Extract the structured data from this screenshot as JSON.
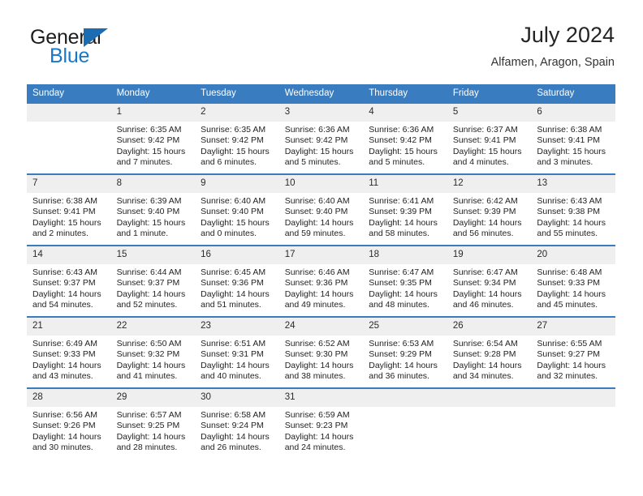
{
  "brand": {
    "name_top": "General",
    "name_bottom": "Blue",
    "colors": {
      "dark": "#1d1d1b",
      "blue": "#1877c9",
      "triangle": "#1b6cb3"
    }
  },
  "header": {
    "title": "July 2024",
    "subtitle": "Alfamen, Aragon, Spain"
  },
  "theme": {
    "header_bg": "#3a7cc0",
    "daynum_bg": "#efefef",
    "row_divider": "#3a7cc0",
    "text": "#232323"
  },
  "weekdays": [
    "Sunday",
    "Monday",
    "Tuesday",
    "Wednesday",
    "Thursday",
    "Friday",
    "Saturday"
  ],
  "weeks": [
    [
      {
        "day": "",
        "sunrise": "",
        "sunset": "",
        "daylight_1": "",
        "daylight_2": ""
      },
      {
        "day": "1",
        "sunrise": "Sunrise: 6:35 AM",
        "sunset": "Sunset: 9:42 PM",
        "daylight_1": "Daylight: 15 hours",
        "daylight_2": "and 7 minutes."
      },
      {
        "day": "2",
        "sunrise": "Sunrise: 6:35 AM",
        "sunset": "Sunset: 9:42 PM",
        "daylight_1": "Daylight: 15 hours",
        "daylight_2": "and 6 minutes."
      },
      {
        "day": "3",
        "sunrise": "Sunrise: 6:36 AM",
        "sunset": "Sunset: 9:42 PM",
        "daylight_1": "Daylight: 15 hours",
        "daylight_2": "and 5 minutes."
      },
      {
        "day": "4",
        "sunrise": "Sunrise: 6:36 AM",
        "sunset": "Sunset: 9:42 PM",
        "daylight_1": "Daylight: 15 hours",
        "daylight_2": "and 5 minutes."
      },
      {
        "day": "5",
        "sunrise": "Sunrise: 6:37 AM",
        "sunset": "Sunset: 9:41 PM",
        "daylight_1": "Daylight: 15 hours",
        "daylight_2": "and 4 minutes."
      },
      {
        "day": "6",
        "sunrise": "Sunrise: 6:38 AM",
        "sunset": "Sunset: 9:41 PM",
        "daylight_1": "Daylight: 15 hours",
        "daylight_2": "and 3 minutes."
      }
    ],
    [
      {
        "day": "7",
        "sunrise": "Sunrise: 6:38 AM",
        "sunset": "Sunset: 9:41 PM",
        "daylight_1": "Daylight: 15 hours",
        "daylight_2": "and 2 minutes."
      },
      {
        "day": "8",
        "sunrise": "Sunrise: 6:39 AM",
        "sunset": "Sunset: 9:40 PM",
        "daylight_1": "Daylight: 15 hours",
        "daylight_2": "and 1 minute."
      },
      {
        "day": "9",
        "sunrise": "Sunrise: 6:40 AM",
        "sunset": "Sunset: 9:40 PM",
        "daylight_1": "Daylight: 15 hours",
        "daylight_2": "and 0 minutes."
      },
      {
        "day": "10",
        "sunrise": "Sunrise: 6:40 AM",
        "sunset": "Sunset: 9:40 PM",
        "daylight_1": "Daylight: 14 hours",
        "daylight_2": "and 59 minutes."
      },
      {
        "day": "11",
        "sunrise": "Sunrise: 6:41 AM",
        "sunset": "Sunset: 9:39 PM",
        "daylight_1": "Daylight: 14 hours",
        "daylight_2": "and 58 minutes."
      },
      {
        "day": "12",
        "sunrise": "Sunrise: 6:42 AM",
        "sunset": "Sunset: 9:39 PM",
        "daylight_1": "Daylight: 14 hours",
        "daylight_2": "and 56 minutes."
      },
      {
        "day": "13",
        "sunrise": "Sunrise: 6:43 AM",
        "sunset": "Sunset: 9:38 PM",
        "daylight_1": "Daylight: 14 hours",
        "daylight_2": "and 55 minutes."
      }
    ],
    [
      {
        "day": "14",
        "sunrise": "Sunrise: 6:43 AM",
        "sunset": "Sunset: 9:37 PM",
        "daylight_1": "Daylight: 14 hours",
        "daylight_2": "and 54 minutes."
      },
      {
        "day": "15",
        "sunrise": "Sunrise: 6:44 AM",
        "sunset": "Sunset: 9:37 PM",
        "daylight_1": "Daylight: 14 hours",
        "daylight_2": "and 52 minutes."
      },
      {
        "day": "16",
        "sunrise": "Sunrise: 6:45 AM",
        "sunset": "Sunset: 9:36 PM",
        "daylight_1": "Daylight: 14 hours",
        "daylight_2": "and 51 minutes."
      },
      {
        "day": "17",
        "sunrise": "Sunrise: 6:46 AM",
        "sunset": "Sunset: 9:36 PM",
        "daylight_1": "Daylight: 14 hours",
        "daylight_2": "and 49 minutes."
      },
      {
        "day": "18",
        "sunrise": "Sunrise: 6:47 AM",
        "sunset": "Sunset: 9:35 PM",
        "daylight_1": "Daylight: 14 hours",
        "daylight_2": "and 48 minutes."
      },
      {
        "day": "19",
        "sunrise": "Sunrise: 6:47 AM",
        "sunset": "Sunset: 9:34 PM",
        "daylight_1": "Daylight: 14 hours",
        "daylight_2": "and 46 minutes."
      },
      {
        "day": "20",
        "sunrise": "Sunrise: 6:48 AM",
        "sunset": "Sunset: 9:33 PM",
        "daylight_1": "Daylight: 14 hours",
        "daylight_2": "and 45 minutes."
      }
    ],
    [
      {
        "day": "21",
        "sunrise": "Sunrise: 6:49 AM",
        "sunset": "Sunset: 9:33 PM",
        "daylight_1": "Daylight: 14 hours",
        "daylight_2": "and 43 minutes."
      },
      {
        "day": "22",
        "sunrise": "Sunrise: 6:50 AM",
        "sunset": "Sunset: 9:32 PM",
        "daylight_1": "Daylight: 14 hours",
        "daylight_2": "and 41 minutes."
      },
      {
        "day": "23",
        "sunrise": "Sunrise: 6:51 AM",
        "sunset": "Sunset: 9:31 PM",
        "daylight_1": "Daylight: 14 hours",
        "daylight_2": "and 40 minutes."
      },
      {
        "day": "24",
        "sunrise": "Sunrise: 6:52 AM",
        "sunset": "Sunset: 9:30 PM",
        "daylight_1": "Daylight: 14 hours",
        "daylight_2": "and 38 minutes."
      },
      {
        "day": "25",
        "sunrise": "Sunrise: 6:53 AM",
        "sunset": "Sunset: 9:29 PM",
        "daylight_1": "Daylight: 14 hours",
        "daylight_2": "and 36 minutes."
      },
      {
        "day": "26",
        "sunrise": "Sunrise: 6:54 AM",
        "sunset": "Sunset: 9:28 PM",
        "daylight_1": "Daylight: 14 hours",
        "daylight_2": "and 34 minutes."
      },
      {
        "day": "27",
        "sunrise": "Sunrise: 6:55 AM",
        "sunset": "Sunset: 9:27 PM",
        "daylight_1": "Daylight: 14 hours",
        "daylight_2": "and 32 minutes."
      }
    ],
    [
      {
        "day": "28",
        "sunrise": "Sunrise: 6:56 AM",
        "sunset": "Sunset: 9:26 PM",
        "daylight_1": "Daylight: 14 hours",
        "daylight_2": "and 30 minutes."
      },
      {
        "day": "29",
        "sunrise": "Sunrise: 6:57 AM",
        "sunset": "Sunset: 9:25 PM",
        "daylight_1": "Daylight: 14 hours",
        "daylight_2": "and 28 minutes."
      },
      {
        "day": "30",
        "sunrise": "Sunrise: 6:58 AM",
        "sunset": "Sunset: 9:24 PM",
        "daylight_1": "Daylight: 14 hours",
        "daylight_2": "and 26 minutes."
      },
      {
        "day": "31",
        "sunrise": "Sunrise: 6:59 AM",
        "sunset": "Sunset: 9:23 PM",
        "daylight_1": "Daylight: 14 hours",
        "daylight_2": "and 24 minutes."
      },
      {
        "day": "",
        "sunrise": "",
        "sunset": "",
        "daylight_1": "",
        "daylight_2": ""
      },
      {
        "day": "",
        "sunrise": "",
        "sunset": "",
        "daylight_1": "",
        "daylight_2": ""
      },
      {
        "day": "",
        "sunrise": "",
        "sunset": "",
        "daylight_1": "",
        "daylight_2": ""
      }
    ]
  ]
}
